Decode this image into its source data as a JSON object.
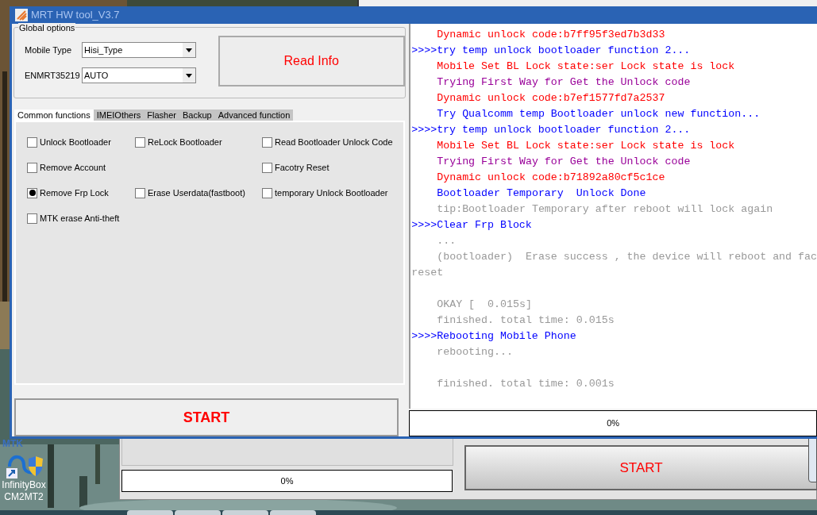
{
  "window": {
    "title": "MRT HW tool_V3.7"
  },
  "global_options": {
    "title": "Global options",
    "fields": [
      {
        "label": "Mobile Type",
        "value": "Hisi_Type"
      },
      {
        "label": "ENMRT35219",
        "value": "AUTO"
      }
    ],
    "read_button": "Read Info"
  },
  "tabs": [
    {
      "label": "Common functions",
      "selected": true
    },
    {
      "label": "IMEIOthers",
      "selected": false
    },
    {
      "label": "Flasher",
      "selected": false
    },
    {
      "label": "Backup",
      "selected": false
    },
    {
      "label": "Advanced function",
      "selected": false
    }
  ],
  "options": [
    {
      "left": {
        "label": "Unlock Bootloader",
        "checked": false
      },
      "middle": {
        "label": "ReLock Bootloader",
        "checked": false
      },
      "right": {
        "label": "Read Bootloader Unlock Code",
        "checked": false
      }
    },
    {
      "left": {
        "label": "Remove Account",
        "checked": false
      },
      "right": {
        "label": "Facotry Reset",
        "checked": false
      }
    },
    {
      "left": {
        "label": "Remove Frp Lock",
        "checked": true
      },
      "middle": {
        "label": "Erase Userdata(fastboot)",
        "checked": false
      },
      "right": {
        "label": "temporary Unlock Bootloader",
        "checked": false
      }
    },
    {
      "left": {
        "label": "MTK erase Anti-theft",
        "checked": false
      }
    }
  ],
  "start_button": "START",
  "log": [
    {
      "text": "Dynamic unlock code:b7ff95f3ed7b3d33",
      "color": "#ff0000",
      "indented": true,
      "space_before": false
    },
    {
      "text": ">>>>try temp unlock bootloader function 2...",
      "color": "#0000ff",
      "indented": false,
      "space_before": false
    },
    {
      "text": "Mobile Set BL Lock state:ser Lock state is lock",
      "color": "#ff0000",
      "indented": true,
      "space_before": false
    },
    {
      "text": "Trying First Way for Get the Unlock code",
      "color": "#990099",
      "indented": true,
      "space_before": false
    },
    {
      "text": "Dynamic unlock code:b7ef1577fd7a2537",
      "color": "#ff0000",
      "indented": true,
      "space_before": false
    },
    {
      "text": "Try Qualcomm temp Bootloader unlock new function...",
      "color": "#0000ff",
      "indented": true,
      "space_before": false
    },
    {
      "text": ">>>>try temp unlock bootloader function 2...",
      "color": "#0000ff",
      "indented": false,
      "space_before": false
    },
    {
      "text": "Mobile Set BL Lock state:ser Lock state is lock",
      "color": "#ff0000",
      "indented": true,
      "space_before": false
    },
    {
      "text": "Trying First Way for Get the Unlock code",
      "color": "#990099",
      "indented": true,
      "space_before": false
    },
    {
      "text": "Dynamic unlock code:b71892a80cf5c1ce",
      "color": "#ff0000",
      "indented": true,
      "space_before": false
    },
    {
      "text": "Bootloader Temporary  Unlock Done",
      "color": "#0000ff",
      "indented": true,
      "space_before": false
    },
    {
      "text": "tip:Bootloader Temporary after reboot will lock again",
      "color": "#999999",
      "indented": true,
      "space_before": false
    },
    {
      "text": ">>>>Clear Frp Block",
      "color": "#0000ff",
      "indented": false,
      "space_before": false
    },
    {
      "text": "...",
      "color": "#999999",
      "indented": true,
      "space_before": false
    },
    {
      "text": "(bootloader)  Erase success , the device will reboot and fac",
      "color": "#999999",
      "indented": true,
      "space_before": false
    },
    {
      "text": "reset",
      "color": "#999999",
      "indented": false,
      "space_before": false
    },
    {
      "text": "OKAY [  0.015s]",
      "color": "#999999",
      "indented": true,
      "space_before": true
    },
    {
      "text": "finished. total time: 0.015s",
      "color": "#999999",
      "indented": true,
      "space_before": false
    },
    {
      "text": ">>>>Rebooting Mobile Phone",
      "color": "#0000ff",
      "indented": false,
      "space_before": false
    },
    {
      "text": "rebooting...",
      "color": "#999999",
      "indented": true,
      "space_before": false
    },
    {
      "text": "finished. total time: 0.001s",
      "color": "#999999",
      "indented": true,
      "space_before": true
    }
  ],
  "log_progress": {
    "label": "0%",
    "level": 0
  },
  "background_window": {
    "progress": {
      "label": "0%",
      "level": 0
    },
    "start_button": "START"
  },
  "desktop": {
    "mtk_label": "MTK",
    "icon_label": "InfinityBox CM2MT2"
  }
}
